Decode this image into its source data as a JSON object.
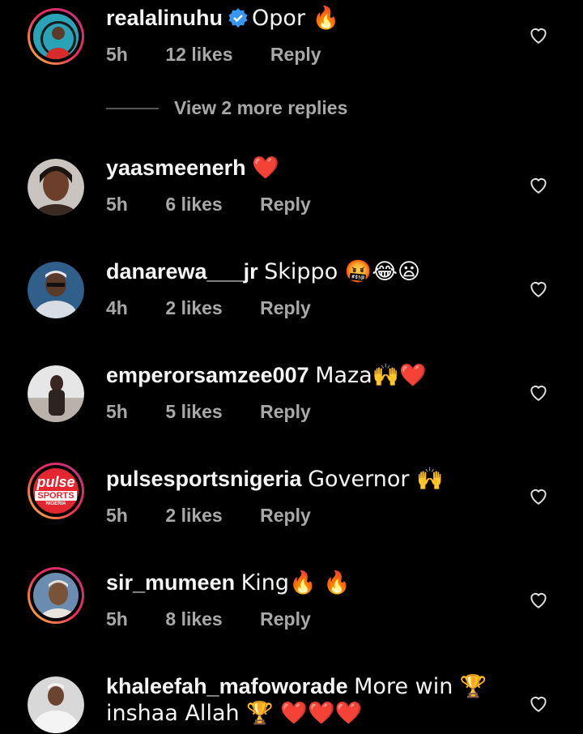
{
  "comments": [
    {
      "username": "realalinuhu",
      "verified": true,
      "text": "Opor 🔥",
      "time": "5h",
      "likes": "12 likes",
      "reply": "Reply"
    },
    {
      "username": "yaasmeenerh",
      "text": "❤️",
      "time": "5h",
      "likes": "6 likes",
      "reply": "Reply"
    },
    {
      "username": "danarewa___jr",
      "text": "Skippo 🤬😂😦",
      "time": "4h",
      "likes": "2 likes",
      "reply": "Reply"
    },
    {
      "username": "emperorsamzee007",
      "text": "Maza🙌❤️",
      "time": "5h",
      "likes": "5 likes",
      "reply": "Reply"
    },
    {
      "username": "pulsesportsnigeria",
      "text": "Governor 🙌",
      "time": "5h",
      "likes": "2 likes",
      "reply": "Reply",
      "avatar_text": {
        "line1": "pulse",
        "line2": "SPORTS",
        "line3": "NIGERIA"
      }
    },
    {
      "username": "sir_mumeen",
      "text": "King🔥 🔥",
      "time": "5h",
      "likes": "8 likes",
      "reply": "Reply"
    },
    {
      "username": "khaleefah_mafoworade",
      "text": "More win 🏆 inshaa Allah 🏆 ❤️❤️❤️"
    }
  ],
  "view_more": "View 2 more replies",
  "colors": {
    "background": "#000000",
    "text": "#f5f5f5",
    "muted": "#a8a8a8",
    "verified": "#3897f0",
    "pulse_red": "#e3262f"
  }
}
